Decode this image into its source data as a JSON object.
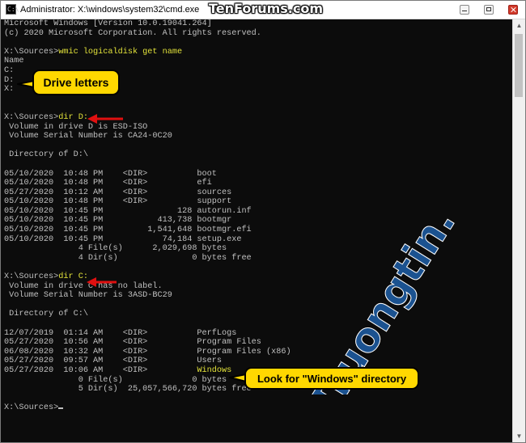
{
  "window": {
    "title": "Administrator: X:\\windows\\system32\\cmd.exe",
    "app_icon_text": "C:\\",
    "icons": {
      "app": "cmd-icon",
      "minimize": "minimize-icon",
      "maximize": "maximize-icon",
      "close": "close-icon"
    }
  },
  "watermarks": {
    "top": "TenForums.com",
    "diagonal": "Truongtin.top"
  },
  "console": {
    "lines": [
      {
        "text": "Microsoft Windows [Version 10.0.19041.264]"
      },
      {
        "text": "(c) 2020 Microsoft Corporation. All rights reserved."
      },
      {
        "text": ""
      },
      {
        "prefix": "X:\\Sources>",
        "command": "wmic logicaldisk get name"
      },
      {
        "text": "Name"
      },
      {
        "text": "C:"
      },
      {
        "text": "D:"
      },
      {
        "text": "X:"
      },
      {
        "text": ""
      },
      {
        "text": ""
      },
      {
        "prefix": "X:\\Sources>",
        "command": "dir D:"
      },
      {
        "text": " Volume in drive D is ESD-ISO"
      },
      {
        "text": " Volume Serial Number is CA24-0C20"
      },
      {
        "text": ""
      },
      {
        "text": " Directory of D:\\"
      },
      {
        "text": ""
      },
      {
        "text": "05/10/2020  10:48 PM    <DIR>          boot"
      },
      {
        "text": "05/10/2020  10:48 PM    <DIR>          efi"
      },
      {
        "text": "05/27/2020  10:12 AM    <DIR>          sources"
      },
      {
        "text": "05/10/2020  10:48 PM    <DIR>          support"
      },
      {
        "text": "05/10/2020  10:45 PM               128 autorun.inf"
      },
      {
        "text": "05/10/2020  10:45 PM           413,738 bootmgr"
      },
      {
        "text": "05/10/2020  10:45 PM         1,541,648 bootmgr.efi"
      },
      {
        "text": "05/10/2020  10:45 PM            74,184 setup.exe"
      },
      {
        "text": "               4 File(s)      2,029,698 bytes"
      },
      {
        "text": "               4 Dir(s)               0 bytes free"
      },
      {
        "text": ""
      },
      {
        "prefix": "X:\\Sources>",
        "command": "dir C:"
      },
      {
        "text": " Volume in drive C has no label."
      },
      {
        "text": " Volume Serial Number is 3ASD-BC29"
      },
      {
        "text": ""
      },
      {
        "text": " Directory of C:\\"
      },
      {
        "text": ""
      },
      {
        "text": "12/07/2019  01:14 AM    <DIR>          PerfLogs"
      },
      {
        "text": "05/27/2020  10:56 AM    <DIR>          Program Files"
      },
      {
        "text": "06/08/2020  10:32 AM    <DIR>          Program Files (x86)"
      },
      {
        "text": "05/27/2020  09:57 AM    <DIR>          Users"
      },
      {
        "prefix": "05/27/2020  10:06 AM    <DIR>          ",
        "command": "Windows"
      },
      {
        "text": "               0 File(s)              0 bytes"
      },
      {
        "text": "               5 Dir(s)  25,057,566,720 bytes free"
      },
      {
        "text": ""
      },
      {
        "prefix": "X:\\Sources>",
        "command": "",
        "cursor": true
      }
    ]
  },
  "annotations": {
    "drive_letters": "Drive letters",
    "look_for_windows": "Look for \"Windows\" directory"
  },
  "colors": {
    "console_background": "#0c0c0c",
    "console_text": "#c0c0c0",
    "command_highlight": "#e2e23a",
    "callout_fill": "#ffd800",
    "arrow_red": "#e01010"
  },
  "scrollbar": {
    "up_icon": "scroll-up-arrow-icon",
    "down_icon": "scroll-down-arrow-icon"
  }
}
